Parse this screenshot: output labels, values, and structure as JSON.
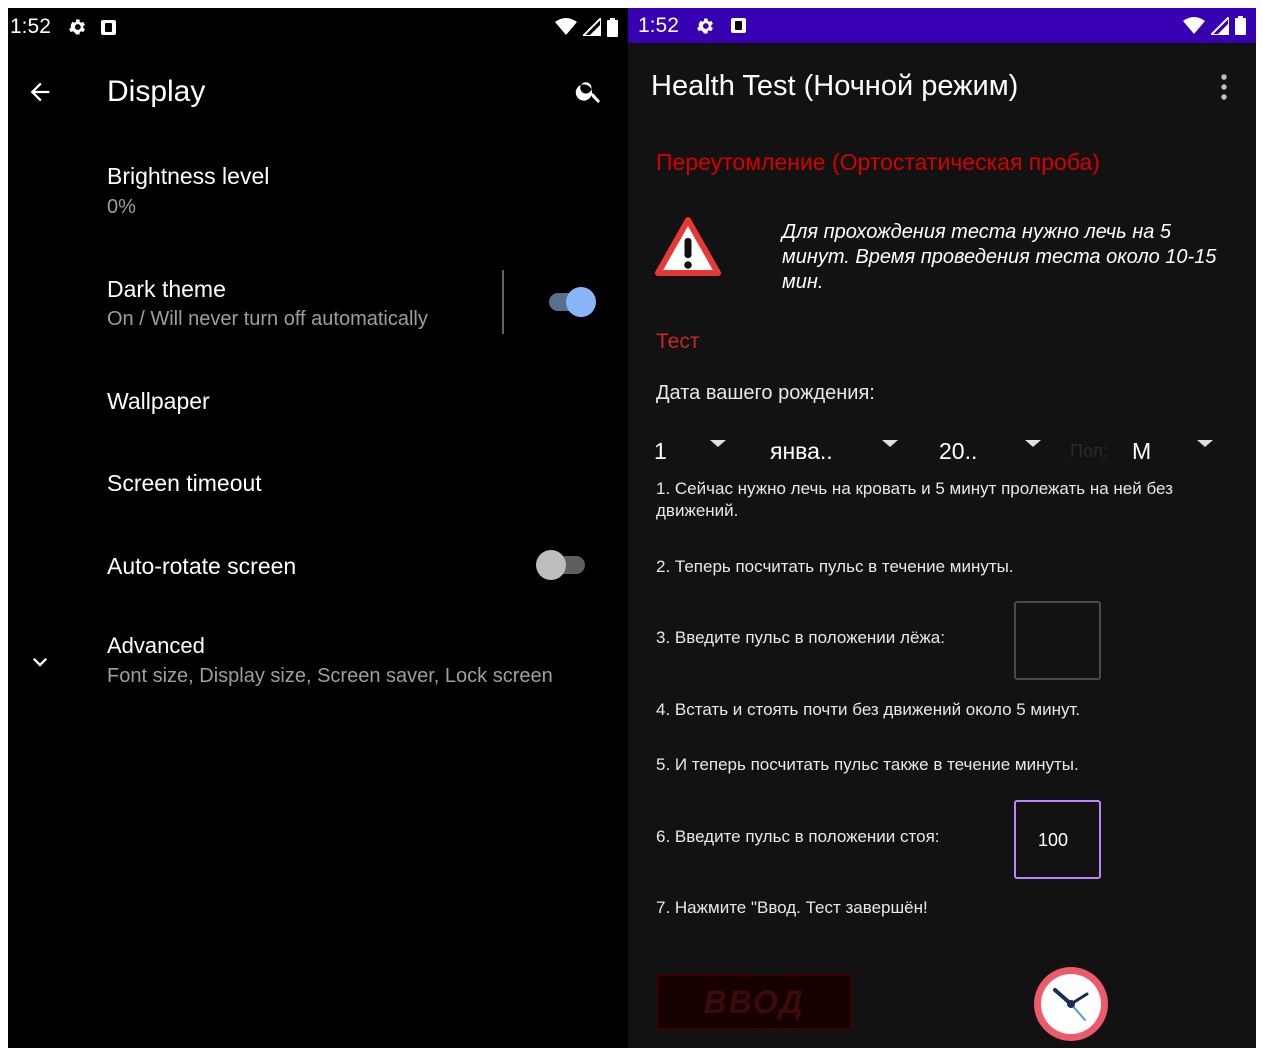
{
  "left": {
    "status_time": "1:52",
    "title": "Display",
    "prefs": {
      "brightness": {
        "title": "Brightness level",
        "summary": "0%"
      },
      "dark_theme": {
        "title": "Dark theme",
        "summary": "On / Will never turn off automatically",
        "on": true
      },
      "wallpaper": {
        "title": "Wallpaper"
      },
      "timeout": {
        "title": "Screen timeout"
      },
      "autorotate": {
        "title": "Auto-rotate screen",
        "on": false
      },
      "advanced": {
        "title": "Advanced",
        "summary": "Font size, Display size, Screen saver, Lock screen"
      }
    },
    "colors": {
      "accent": "#8ab4f8",
      "accent_track": "#5a6f8f"
    }
  },
  "right": {
    "status_time": "1:52",
    "title": "Health Test (Ночной режим)",
    "heading": "Переутомление (Ортостатическая проба)",
    "warning": "Для прохождения теста нужно лечь на 5 минут. Время проведения теста около 10-15 мин.",
    "section": "Тест",
    "birth_label": "Дата вашего рождения:",
    "day": "1",
    "month": "янва..",
    "year": "20..",
    "sex_label": "Пол:",
    "sex": "М",
    "steps": [
      "1. Сейчас нужно лечь на кровать и 5 минут пролежать на ней без движений.",
      "2. Теперь посчитать пульс в течение минуты.",
      "3. Введите пульс в положении лёжа:",
      "4. Встать и стоять почти без движений около 5 минут.",
      "5. И теперь посчитать пульс также в течение минуты.",
      "6. Введите пульс в положении стоя:",
      "7. Нажмите \"Ввод. Тест завершён!"
    ],
    "pulse_lying": "",
    "pulse_standing": "100",
    "enter_button": "ВВОД",
    "colors": {
      "statusbar": "#3700b3",
      "heading": "#d50000",
      "focus": "#bb86fc"
    }
  }
}
